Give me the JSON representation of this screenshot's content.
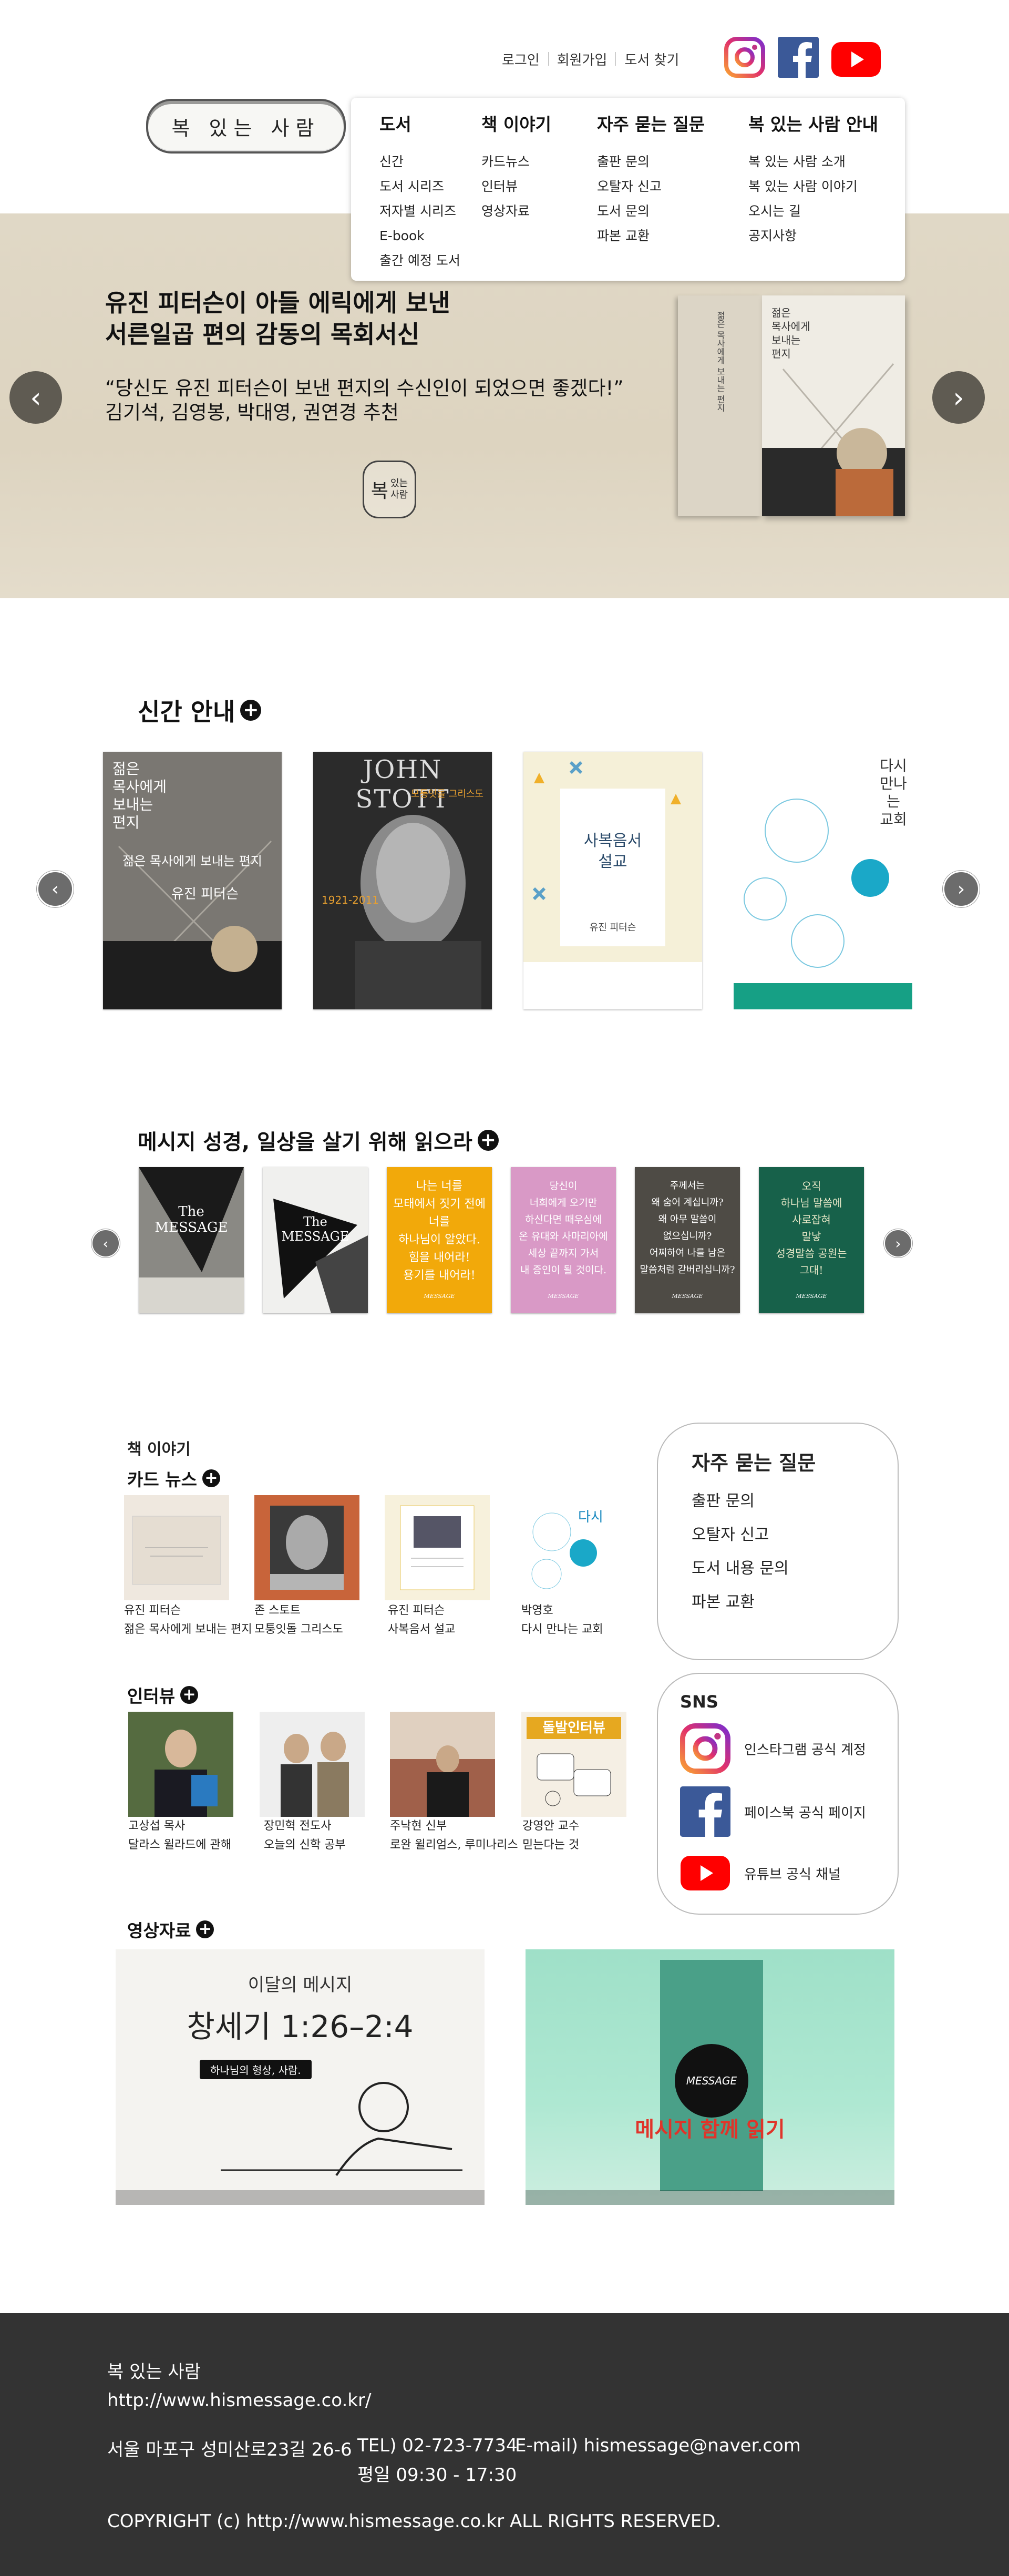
{
  "header": {
    "top_links": [
      "로그인",
      "회원가입",
      "도서 찾기"
    ],
    "logo_text": "복 있는 사람",
    "sns_icons": [
      "instagram-icon",
      "facebook-icon",
      "youtube-icon"
    ],
    "menu": [
      {
        "title": "도서",
        "items": [
          "신간",
          "도서 시리즈",
          "저자별 시리즈",
          "E-book",
          "출간 예정 도서"
        ]
      },
      {
        "title": "책 이야기",
        "items": [
          "카드뉴스",
          "인터뷰",
          "영상자료"
        ]
      },
      {
        "title": "자주 묻는 질문",
        "items": [
          "출판 문의",
          "오탈자 신고",
          "도서 문의",
          "파본 교환"
        ]
      },
      {
        "title": "복 있는 사람 안내",
        "items": [
          "복 있는 사람 소개",
          "복 있는 사람 이야기",
          "오시는 길",
          "공지사항"
        ]
      }
    ]
  },
  "hero": {
    "title_line1": "유진 피터슨이 아들 에릭에게 보낸",
    "title_line2": "서른일곱 편의 감동의 목회서신",
    "quote": "“당신도 유진 피터슨이 보낸 편지의 수신인이 되었으면 좋겠다!”",
    "recommenders": "김기석, 김영봉, 박대영, 권연경 추천",
    "stamp_line1": "복",
    "stamp_line2": "있는",
    "stamp_line3": "사람",
    "book_spine": "젊은 목사에게 보내는 편지",
    "book_cover": "젊은\n목사에게\n보내는\n편지",
    "arrow_prev": "‹",
    "arrow_next": "›"
  },
  "new_books": {
    "title": "신간 안내",
    "books": [
      {
        "title": "젊은\n목사에게\n보내는\n편지",
        "subtitle": "젊은 목사에게 보내는 편지",
        "author": "유진 피터슨"
      },
      {
        "title": "JOHN STOTT",
        "subtitle": "모퉁잇돌 그리스도",
        "years": "1921-2011"
      },
      {
        "title": "사복음서\n설교",
        "author": "유진 피터슨"
      },
      {
        "title": "다시\n만나는\n교회"
      }
    ]
  },
  "message_books": {
    "title": "메시지 성경, 일상을 살기 위해 읽으라",
    "books": [
      {
        "text": "The\nMESSAGE",
        "color": "#7a7a78"
      },
      {
        "text": "The\nMESSAGE",
        "color": "#e8e8e6"
      },
      {
        "text": "나는 너를\n모태에서 짓기 전에\n너를\n하나님이 알았다.\n힘을 내어라!\n용기를 내어라!",
        "color": "#f2a90a"
      },
      {
        "text": "당신이\n너희에게 오기만\n하신다면 때우심에\n온 유대와 사마리아에\n세상 끝까지 가서\n내 증인이 될 것이다.",
        "color": "#d999c6"
      },
      {
        "text": "주께서는\n왜 숨어 계십니까?\n왜 아무 말씀이\n없으십니까?\n어찌하여 나를 남은\n말씀처럼 갇버리십니까?",
        "color": "#4e4b45"
      },
      {
        "text": "오직\n하나님 말씀에\n사로잡혀\n말낳\n성경말씀 공원는\n그대!",
        "color": "#17614a"
      }
    ],
    "logo": "MESSAGE"
  },
  "book_story": {
    "label": "책 이야기",
    "card_news": {
      "title": "카드 뉴스",
      "items": [
        {
          "author": "유진 피터슨",
          "title": "젊은 목사에게 보내는 편지"
        },
        {
          "author": "존 스토트",
          "title": "모퉁잇돌 그리스도"
        },
        {
          "author": "유진 피터슨",
          "title": "사복음서 설교"
        },
        {
          "author": "박영호",
          "title": "다시 만나는 교회"
        }
      ]
    },
    "interviews": {
      "title": "인터뷰",
      "items": [
        {
          "name": "고상섭 목사",
          "topic": "달라스 윌라드에 관해"
        },
        {
          "name": "장민혁 전도사",
          "topic": "오늘의 신학 공부"
        },
        {
          "name": "주낙현 신부",
          "topic": "로완 윌리엄스, 루미나리스"
        },
        {
          "name": "강영안 교수",
          "topic": "믿는다는 것"
        }
      ],
      "dol_label": "돌발인터뷰"
    },
    "videos": {
      "title": "영상자료",
      "items": [
        {
          "label": "이달의 메시지",
          "verse": "창세기 1:26–2:4",
          "sub": "하나님의 형상, 사람."
        },
        {
          "label": "메시지 함께 읽기",
          "logo": "MESSAGE"
        }
      ]
    }
  },
  "faq": {
    "title": "자주 묻는 질문",
    "items": [
      "출판 문의",
      "오탈자 신고",
      "도서 내용 문의",
      "파본 교환"
    ]
  },
  "sns": {
    "title": "SNS",
    "items": [
      {
        "icon": "instagram-icon",
        "label": "인스타그램 공식 계정"
      },
      {
        "icon": "facebook-icon",
        "label": "페이스북 공식 페이지"
      },
      {
        "icon": "youtube-icon",
        "label": "유튜브 공식 채널"
      }
    ]
  },
  "footer": {
    "name": "복 있는 사람",
    "url": "http://www.hismessage.co.kr/",
    "address": "서울 마포구 성미산로23길 26-6",
    "tel": "TEL) 02-723-7734",
    "email": "E-mail) hismessage@naver.com",
    "hours": "평일 09:30 - 17:30",
    "copyright": "COPYRIGHT (c) http://www.hismessage.co.kr ALL RIGHTS RESERVED."
  },
  "colors": {
    "hero_bg": "#ddd4c0",
    "footer_bg": "#333333",
    "message_yellow": "#f2a90a",
    "message_pink": "#d999c6",
    "message_green": "#17614a"
  }
}
